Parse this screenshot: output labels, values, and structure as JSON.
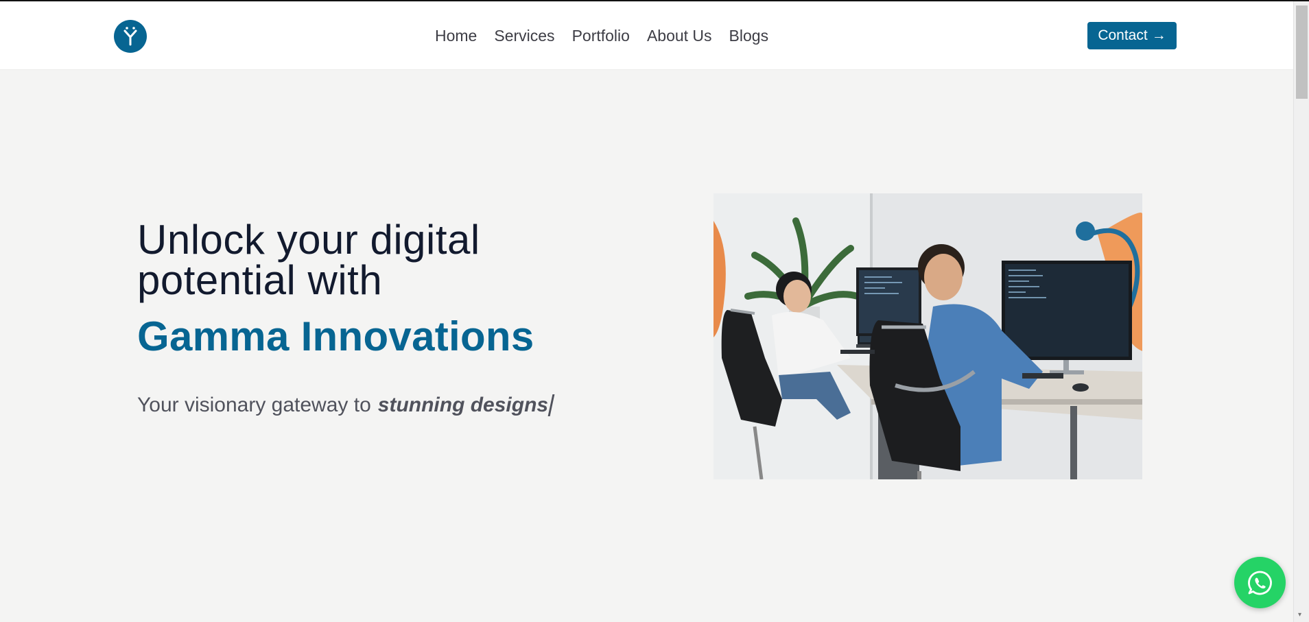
{
  "header": {
    "logo_letter": "Y",
    "nav": [
      {
        "label": "Home"
      },
      {
        "label": "Services"
      },
      {
        "label": "Portfolio"
      },
      {
        "label": "About Us"
      },
      {
        "label": "Blogs"
      }
    ],
    "contact_label": "Contact",
    "contact_arrow": "→"
  },
  "hero": {
    "line1": "Unlock your digital",
    "line2": "potential with",
    "brand": "Gamma Innovations",
    "tagline_prefix": "Your visionary gateway to",
    "tagline_typed": "stunning designs"
  },
  "colors": {
    "brand": "#076592",
    "page_bg": "#f4f4f3",
    "whatsapp": "#25d366"
  },
  "icons": {
    "logo": "y-logo-icon",
    "whatsapp": "whatsapp-icon",
    "contact": "arrow-right-icon"
  }
}
